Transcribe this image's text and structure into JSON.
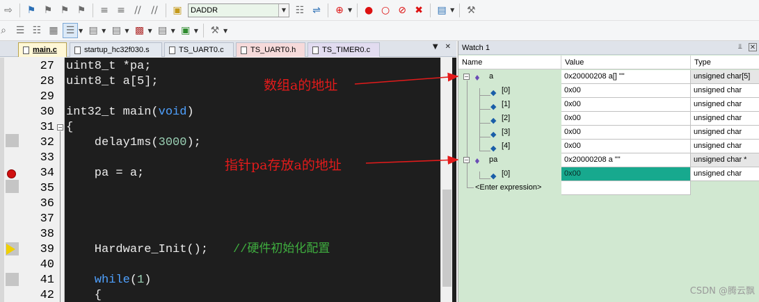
{
  "toolbar": {
    "target_name": "DADDR"
  },
  "tabs": [
    {
      "label": "main.c",
      "active": true
    },
    {
      "label": "startup_hc32f030.s"
    },
    {
      "label": "TS_UART0.c"
    },
    {
      "label": "TS_UART0.h"
    },
    {
      "label": "TS_TIMER0.c"
    }
  ],
  "editor": {
    "line_numbers": [
      "27",
      "28",
      "29",
      "30",
      "31",
      "32",
      "33",
      "34",
      "35",
      "36",
      "37",
      "38",
      "39",
      "40",
      "41",
      "42"
    ],
    "breakpoint_line": "34",
    "current_line": "39",
    "code": {
      "l27": "uint8_t *pa;",
      "l28": "uint8_t a[5];",
      "l30_a": "int32_t main(",
      "l30_kw": "void",
      "l30_b": ")",
      "l31": "{",
      "l32_a": "    delay1ms(",
      "l32_num": "3000",
      "l32_b": ");",
      "l34": "    pa = a;",
      "l39_a": "    Hardware_Init();",
      "l39_cm": "//硬件初始化配置",
      "l41_kw": "    while",
      "l41_a": "(",
      "l41_num": "1",
      "l41_b": ")",
      "l42": "    {"
    },
    "annotations": {
      "array_addr": "数组a的地址",
      "pointer_addr": "指针pa存放a的地址"
    }
  },
  "watch": {
    "title": "Watch 1",
    "headers": {
      "name": "Name",
      "value": "Value",
      "type": "Type"
    },
    "rows": [
      {
        "name": "a",
        "value": "0x20000208 a[] \"\"",
        "type": "unsigned char[5]"
      },
      {
        "name": "[0]",
        "value": "0x00",
        "type": "unsigned char"
      },
      {
        "name": "[1]",
        "value": "0x00",
        "type": "unsigned char"
      },
      {
        "name": "[2]",
        "value": "0x00",
        "type": "unsigned char"
      },
      {
        "name": "[3]",
        "value": "0x00",
        "type": "unsigned char"
      },
      {
        "name": "[4]",
        "value": "0x00",
        "type": "unsigned char"
      },
      {
        "name": "pa",
        "value": "0x20000208 a \"\"",
        "type": "unsigned char *"
      },
      {
        "name": "[0]",
        "value": "0x00",
        "type": "unsigned char"
      }
    ],
    "enter_expression": "<Enter expression>"
  },
  "watermark": "CSDN @腾云飘",
  "colors": {
    "editor_bg": "#1e1e1e",
    "keyword": "#4fa1ff",
    "comment": "#3fae3f",
    "annotation": "#e31b1b",
    "watch_bg": "#d1e8d1",
    "value_highlight": "#17a98e"
  }
}
